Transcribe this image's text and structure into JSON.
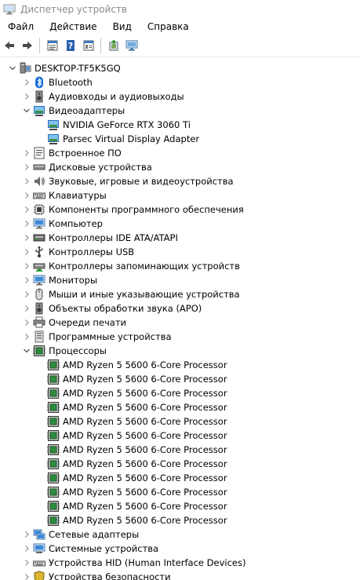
{
  "window": {
    "title": "Диспетчер устройств"
  },
  "menu": [
    {
      "label": "Файл"
    },
    {
      "label": "Действие"
    },
    {
      "label": "Вид"
    },
    {
      "label": "Справка"
    }
  ],
  "toolbar": [
    {
      "name": "back-button",
      "icon": "arrow-left-icon"
    },
    {
      "name": "forward-button",
      "icon": "arrow-right-icon"
    },
    {
      "sep": true
    },
    {
      "name": "properties-button",
      "icon": "properties-icon"
    },
    {
      "name": "help-button",
      "icon": "help-icon"
    },
    {
      "name": "show-hidden-button",
      "icon": "view-icon"
    },
    {
      "sep": true
    },
    {
      "name": "update-driver-button",
      "icon": "update-driver-icon"
    },
    {
      "name": "scan-hardware-button",
      "icon": "scan-monitor-icon"
    }
  ],
  "tree": [
    {
      "label": "DESKTOP-TF5K5GQ",
      "level": 0,
      "state": "expanded",
      "icon": "computer-icon"
    },
    {
      "label": "Bluetooth",
      "level": 1,
      "state": "collapsed",
      "icon": "bluetooth-icon"
    },
    {
      "label": "Аудиовходы и аудиовыходы",
      "level": 1,
      "state": "collapsed",
      "icon": "speaker-icon"
    },
    {
      "label": "Видеоадаптеры",
      "level": 1,
      "state": "expanded",
      "icon": "display-adapter-icon"
    },
    {
      "label": "NVIDIA GeForce RTX 3060 Ti",
      "level": 2,
      "state": "leaf",
      "icon": "display-adapter-icon"
    },
    {
      "label": "Parsec Virtual Display Adapter",
      "level": 2,
      "state": "leaf",
      "icon": "display-adapter-icon"
    },
    {
      "label": "Встроенное ПО",
      "level": 1,
      "state": "collapsed",
      "icon": "firmware-icon"
    },
    {
      "label": "Дисковые устройства",
      "level": 1,
      "state": "collapsed",
      "icon": "disk-icon"
    },
    {
      "label": "Звуковые, игровые и видеоустройства",
      "level": 1,
      "state": "collapsed",
      "icon": "sound-icon"
    },
    {
      "label": "Клавиатуры",
      "level": 1,
      "state": "collapsed",
      "icon": "keyboard-icon"
    },
    {
      "label": "Компоненты программного обеспечения",
      "level": 1,
      "state": "collapsed",
      "icon": "software-component-icon"
    },
    {
      "label": "Компьютер",
      "level": 1,
      "state": "collapsed",
      "icon": "monitor-icon"
    },
    {
      "label": "Контроллеры IDE ATA/ATAPI",
      "level": 1,
      "state": "collapsed",
      "icon": "ide-controller-icon"
    },
    {
      "label": "Контроллеры USB",
      "level": 1,
      "state": "collapsed",
      "icon": "usb-icon"
    },
    {
      "label": "Контроллеры запоминающих устройств",
      "level": 1,
      "state": "collapsed",
      "icon": "storage-controller-icon"
    },
    {
      "label": "Мониторы",
      "level": 1,
      "state": "collapsed",
      "icon": "monitor-icon"
    },
    {
      "label": "Мыши и иные указывающие устройства",
      "level": 1,
      "state": "collapsed",
      "icon": "mouse-icon"
    },
    {
      "label": "Объекты обработки звука (APO)",
      "level": 1,
      "state": "collapsed",
      "icon": "speaker-icon"
    },
    {
      "label": "Очереди печати",
      "level": 1,
      "state": "collapsed",
      "icon": "printer-icon"
    },
    {
      "label": "Программные устройства",
      "level": 1,
      "state": "collapsed",
      "icon": "software-device-icon"
    },
    {
      "label": "Процессоры",
      "level": 1,
      "state": "expanded",
      "icon": "processor-icon"
    },
    {
      "label": "AMD Ryzen 5 5600 6-Core Processor",
      "level": 2,
      "state": "leaf",
      "icon": "processor-icon"
    },
    {
      "label": "AMD Ryzen 5 5600 6-Core Processor",
      "level": 2,
      "state": "leaf",
      "icon": "processor-icon"
    },
    {
      "label": "AMD Ryzen 5 5600 6-Core Processor",
      "level": 2,
      "state": "leaf",
      "icon": "processor-icon"
    },
    {
      "label": "AMD Ryzen 5 5600 6-Core Processor",
      "level": 2,
      "state": "leaf",
      "icon": "processor-icon"
    },
    {
      "label": "AMD Ryzen 5 5600 6-Core Processor",
      "level": 2,
      "state": "leaf",
      "icon": "processor-icon"
    },
    {
      "label": "AMD Ryzen 5 5600 6-Core Processor",
      "level": 2,
      "state": "leaf",
      "icon": "processor-icon"
    },
    {
      "label": "AMD Ryzen 5 5600 6-Core Processor",
      "level": 2,
      "state": "leaf",
      "icon": "processor-icon"
    },
    {
      "label": "AMD Ryzen 5 5600 6-Core Processor",
      "level": 2,
      "state": "leaf",
      "icon": "processor-icon"
    },
    {
      "label": "AMD Ryzen 5 5600 6-Core Processor",
      "level": 2,
      "state": "leaf",
      "icon": "processor-icon"
    },
    {
      "label": "AMD Ryzen 5 5600 6-Core Processor",
      "level": 2,
      "state": "leaf",
      "icon": "processor-icon"
    },
    {
      "label": "AMD Ryzen 5 5600 6-Core Processor",
      "level": 2,
      "state": "leaf",
      "icon": "processor-icon"
    },
    {
      "label": "AMD Ryzen 5 5600 6-Core Processor",
      "level": 2,
      "state": "leaf",
      "icon": "processor-icon"
    },
    {
      "label": "Сетевые адаптеры",
      "level": 1,
      "state": "collapsed",
      "icon": "network-icon"
    },
    {
      "label": "Системные устройства",
      "level": 1,
      "state": "collapsed",
      "icon": "system-device-icon"
    },
    {
      "label": "Устройства HID (Human Interface Devices)",
      "level": 1,
      "state": "collapsed",
      "icon": "hid-icon"
    },
    {
      "label": "Устройства безопасности",
      "level": 1,
      "state": "collapsed",
      "icon": "security-icon"
    }
  ]
}
